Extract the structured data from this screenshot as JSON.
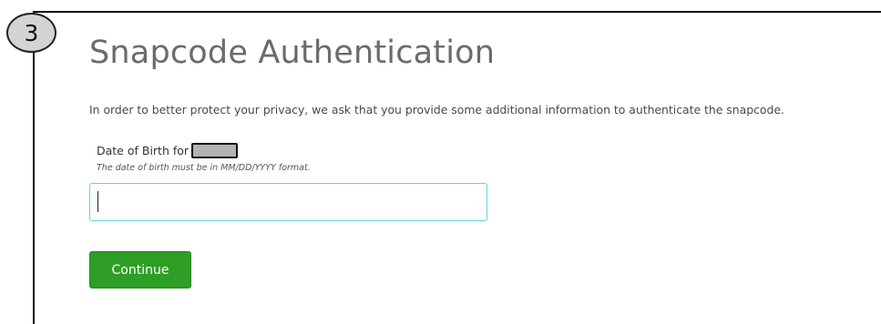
{
  "step_badge": {
    "number": "3"
  },
  "page": {
    "title": "Snapcode Authentication",
    "intro": "In order to better protect your privacy, we ask that you provide some additional information to authenticate the snapcode."
  },
  "dob_field": {
    "label": "Date of Birth for",
    "hint": "The date of birth must be in MM/DD/YYYY format.",
    "value": "",
    "placeholder": ""
  },
  "actions": {
    "continue_label": "Continue"
  },
  "colors": {
    "button_green": "#2e9e26",
    "input_focus_border": "#5fd3df",
    "title_gray": "#6b6b6b",
    "redaction_fill": "#b3b3b3"
  }
}
